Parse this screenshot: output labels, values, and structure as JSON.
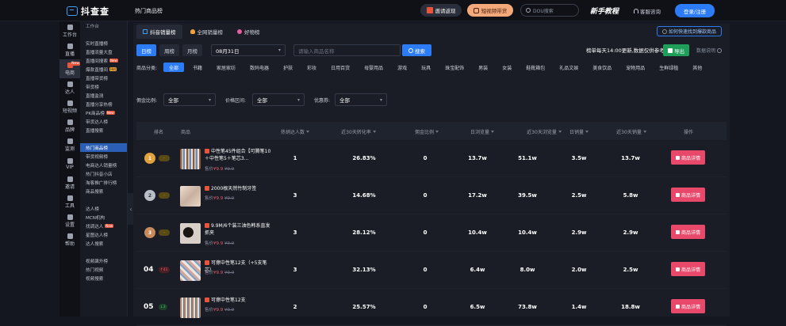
{
  "topbar": {
    "brand": "抖查查",
    "page_title": "热门商品榜",
    "invite": "邀请返现",
    "video_promo": "短视频带货",
    "search_placeholder": "DOU搜索",
    "tutorial": "新手教程",
    "help": "客服咨询",
    "login": "登录/注册"
  },
  "iconbar": [
    {
      "label": "工作台",
      "icon": "dashboard-icon"
    },
    {
      "label": "直播",
      "icon": "live-icon"
    },
    {
      "label": "电商",
      "icon": "shop-icon",
      "active": true,
      "badge": "New"
    },
    {
      "label": "达人",
      "icon": "douyin-icon"
    },
    {
      "label": "短视频",
      "icon": "video-icon"
    },
    {
      "label": "品牌",
      "icon": "brand-icon"
    },
    {
      "label": "监测",
      "icon": "monitor-icon"
    },
    {
      "label": "VIP",
      "icon": "crown-icon"
    },
    {
      "label": "邀请",
      "icon": "invite-icon"
    },
    {
      "label": "工具",
      "icon": "tool-icon"
    },
    {
      "label": "设置",
      "icon": "settings-icon"
    },
    {
      "label": "帮助",
      "icon": "help-icon"
    }
  ],
  "menu": [
    {
      "label": "工作台",
      "head": true
    },
    {
      "label": ""
    },
    {
      "label": "实时直播榜"
    },
    {
      "label": "直播流量大盘"
    },
    {
      "label": "直播间搜索",
      "badge": "New"
    },
    {
      "label": "爆款直播间",
      "badge": "Hot"
    },
    {
      "label": "直播带货榜"
    },
    {
      "label": "带货榜"
    },
    {
      "label": "直播监测"
    },
    {
      "label": "直播分享热榜"
    },
    {
      "label": "PK商品榜",
      "badge": "New"
    },
    {
      "label": "带货达人榜"
    },
    {
      "label": "直播搜索"
    },
    {
      "label": ""
    },
    {
      "label": "热门商品榜",
      "active": true
    },
    {
      "label": "带货视频榜"
    },
    {
      "label": "电商达人销量榜"
    },
    {
      "label": "热门抖音小店"
    },
    {
      "label": "淘客推广排行榜"
    },
    {
      "label": "商品搜索"
    },
    {
      "label": ""
    },
    {
      "label": "达人榜"
    },
    {
      "label": "MCN机构"
    },
    {
      "label": "找调达人",
      "badge": "New"
    },
    {
      "label": "星图达人榜"
    },
    {
      "label": "达人搜索"
    },
    {
      "label": ""
    },
    {
      "label": "视频飙升榜"
    },
    {
      "label": "热门视频"
    },
    {
      "label": "视频搜索"
    }
  ],
  "tabs": [
    {
      "label": "抖音销量榜",
      "active": true,
      "icon": "list-icon"
    },
    {
      "label": "全网销量榜",
      "icon": "fire-icon"
    },
    {
      "label": "好物榜",
      "icon": "heart-icon"
    }
  ],
  "tips": "如何快速找到爆款商品",
  "period": {
    "day": "日榜",
    "week": "周榜",
    "month": "月榜",
    "active": "日榜"
  },
  "date_value": "08月31日",
  "goods_search_placeholder": "请输入商品名称",
  "search_label": "搜索",
  "update_note": "榜单每天14:00更新,数据仅供参考",
  "export_label": "导出",
  "explain_label": "数据说明",
  "category_label": "商品分类:",
  "categories": [
    "全部",
    "书籍",
    "家居家纺",
    "数码电器",
    "护肤",
    "彩妆",
    "日用百货",
    "母婴用品",
    "游戏",
    "玩具",
    "珠宝配饰",
    "男装",
    "女装",
    "鞋靴箱包",
    "礼品文娱",
    "美食饮品",
    "宠物用品",
    "生鲜绿植",
    "其他"
  ],
  "filters": {
    "commission_label": "佣金比例:",
    "commission_value": "全部",
    "price_label": "价格区间:",
    "price_value": "全部",
    "coupon_label": "优惠券:",
    "coupon_value": "全部"
  },
  "columns": [
    "排名",
    "商品",
    "热销达人数",
    "近30天转化率",
    "佣金比例",
    "日浏览量",
    "近30天浏览量",
    "日销量",
    "近30天销量",
    "操作"
  ],
  "rows": [
    {
      "rank": "1",
      "rank_style": "m1",
      "change": "-",
      "change_style": "flat",
      "name": "中性笔45件组合【可腾笔10＋中性笔5＋笔芯3...",
      "price_label": "售价",
      "price": "¥9.9",
      "orig_price": "¥9.9",
      "talents": "1",
      "conversion": "26.83%",
      "commission": "0",
      "daily_views": "13.7w",
      "views_30d": "51.1w",
      "daily_sales": "3.5w",
      "sales_30d": "13.7w",
      "action": "商品详情"
    },
    {
      "rank": "2",
      "rank_style": "m2",
      "change": "-",
      "change_style": "flat",
      "name": "2000根天然竹制牙签",
      "price_label": "售价",
      "price": "¥9.9",
      "orig_price": "¥9.9",
      "talents": "3",
      "conversion": "14.68%",
      "commission": "0",
      "daily_views": "17.2w",
      "views_30d": "39.5w",
      "daily_sales": "2.5w",
      "sales_30d": "5.8w",
      "action": "商品详情"
    },
    {
      "rank": "3",
      "rank_style": "m3",
      "change": "-",
      "change_style": "flat",
      "name": "9.9M/6个装三油色韩系直发抓夹",
      "price_label": "售价",
      "price": "¥9.9",
      "orig_price": "¥9.9",
      "talents": "3",
      "conversion": "28.12%",
      "commission": "0",
      "daily_views": "10.4w",
      "views_30d": "10.4w",
      "daily_sales": "2.9w",
      "sales_30d": "2.9w",
      "action": "商品详情"
    },
    {
      "rank": "04",
      "rank_style": "num",
      "change": "↑41",
      "change_style": "up",
      "name": "可擦中性笔12支（+5支笔芯）",
      "price_label": "售价",
      "price": "¥9.9",
      "orig_price": "¥9.9",
      "talents": "3",
      "conversion": "32.13%",
      "commission": "0",
      "daily_views": "6.4w",
      "views_30d": "8.0w",
      "daily_sales": "2.0w",
      "sales_30d": "2.5w",
      "action": "商品详情"
    },
    {
      "rank": "05",
      "rank_style": "num",
      "change": "↓3",
      "change_style": "up2",
      "name": "可擦中性笔12支",
      "price_label": "售价",
      "price": "¥9.9",
      "orig_price": "¥9.9",
      "talents": "2",
      "conversion": "25.57%",
      "commission": "0",
      "daily_views": "6.5w",
      "views_30d": "73.8w",
      "daily_sales": "1.4w",
      "sales_30d": "18.8w",
      "action": "商品详情"
    }
  ]
}
